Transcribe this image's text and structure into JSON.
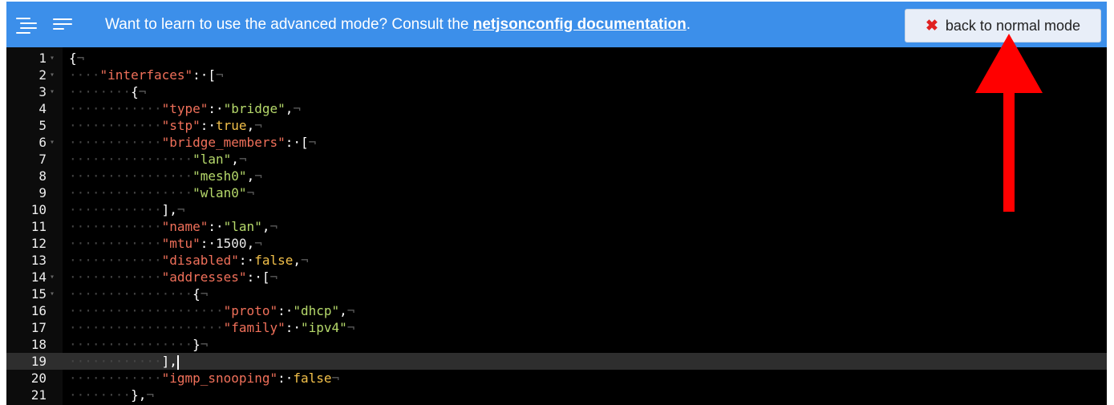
{
  "toolbar": {
    "message_prefix": "Want to learn to use the advanced mode? Consult the ",
    "doc_link": "netjsonconfig documentation",
    "message_suffix": ".",
    "back_button": {
      "icon": "✖",
      "label": "back to normal mode"
    }
  },
  "editor": {
    "active_line": 19,
    "lines": [
      {
        "n": "1",
        "fold": true,
        "tokens": [
          [
            "p",
            "{"
          ],
          [
            "e",
            "¬"
          ]
        ]
      },
      {
        "n": "2",
        "fold": true,
        "tokens": [
          [
            "ws",
            "····"
          ],
          [
            "k",
            "\"interfaces\""
          ],
          [
            "p",
            ":·["
          ],
          [
            "e",
            "¬"
          ]
        ]
      },
      {
        "n": "3",
        "fold": true,
        "tokens": [
          [
            "ws",
            "········"
          ],
          [
            "p",
            "{"
          ],
          [
            "e",
            "¬"
          ]
        ]
      },
      {
        "n": "4",
        "fold": false,
        "tokens": [
          [
            "ws",
            "············"
          ],
          [
            "k",
            "\"type\""
          ],
          [
            "p",
            ":·"
          ],
          [
            "s",
            "\"bridge\""
          ],
          [
            "p",
            ","
          ],
          [
            "e",
            "¬"
          ]
        ]
      },
      {
        "n": "5",
        "fold": false,
        "tokens": [
          [
            "ws",
            "············"
          ],
          [
            "k",
            "\"stp\""
          ],
          [
            "p",
            ":·"
          ],
          [
            "b",
            "true"
          ],
          [
            "p",
            ","
          ],
          [
            "e",
            "¬"
          ]
        ]
      },
      {
        "n": "6",
        "fold": true,
        "tokens": [
          [
            "ws",
            "············"
          ],
          [
            "k",
            "\"bridge_members\""
          ],
          [
            "p",
            ":·["
          ],
          [
            "e",
            "¬"
          ]
        ]
      },
      {
        "n": "7",
        "fold": false,
        "tokens": [
          [
            "ws",
            "················"
          ],
          [
            "s",
            "\"lan\""
          ],
          [
            "p",
            ","
          ],
          [
            "e",
            "¬"
          ]
        ]
      },
      {
        "n": "8",
        "fold": false,
        "tokens": [
          [
            "ws",
            "················"
          ],
          [
            "s",
            "\"mesh0\""
          ],
          [
            "p",
            ","
          ],
          [
            "e",
            "¬"
          ]
        ]
      },
      {
        "n": "9",
        "fold": false,
        "tokens": [
          [
            "ws",
            "················"
          ],
          [
            "s",
            "\"wlan0\""
          ],
          [
            "e",
            "¬"
          ]
        ]
      },
      {
        "n": "10",
        "fold": false,
        "tokens": [
          [
            "ws",
            "············"
          ],
          [
            "p",
            "],"
          ],
          [
            "e",
            "¬"
          ]
        ]
      },
      {
        "n": "11",
        "fold": false,
        "tokens": [
          [
            "ws",
            "············"
          ],
          [
            "k",
            "\"name\""
          ],
          [
            "p",
            ":·"
          ],
          [
            "s",
            "\"lan\""
          ],
          [
            "p",
            ","
          ],
          [
            "e",
            "¬"
          ]
        ]
      },
      {
        "n": "12",
        "fold": false,
        "tokens": [
          [
            "ws",
            "············"
          ],
          [
            "k",
            "\"mtu\""
          ],
          [
            "p",
            ":·"
          ],
          [
            "n",
            "1500"
          ],
          [
            "p",
            ","
          ],
          [
            "e",
            "¬"
          ]
        ]
      },
      {
        "n": "13",
        "fold": false,
        "tokens": [
          [
            "ws",
            "············"
          ],
          [
            "k",
            "\"disabled\""
          ],
          [
            "p",
            ":·"
          ],
          [
            "b",
            "false"
          ],
          [
            "p",
            ","
          ],
          [
            "e",
            "¬"
          ]
        ]
      },
      {
        "n": "14",
        "fold": true,
        "tokens": [
          [
            "ws",
            "············"
          ],
          [
            "k",
            "\"addresses\""
          ],
          [
            "p",
            ":·["
          ],
          [
            "e",
            "¬"
          ]
        ]
      },
      {
        "n": "15",
        "fold": true,
        "tokens": [
          [
            "ws",
            "················"
          ],
          [
            "p",
            "{"
          ],
          [
            "e",
            "¬"
          ]
        ]
      },
      {
        "n": "16",
        "fold": false,
        "tokens": [
          [
            "ws",
            "····················"
          ],
          [
            "k",
            "\"proto\""
          ],
          [
            "p",
            ":·"
          ],
          [
            "s",
            "\"dhcp\""
          ],
          [
            "p",
            ","
          ],
          [
            "e",
            "¬"
          ]
        ]
      },
      {
        "n": "17",
        "fold": false,
        "tokens": [
          [
            "ws",
            "····················"
          ],
          [
            "k",
            "\"family\""
          ],
          [
            "p",
            ":·"
          ],
          [
            "s",
            "\"ipv4\""
          ],
          [
            "e",
            "¬"
          ]
        ]
      },
      {
        "n": "18",
        "fold": false,
        "tokens": [
          [
            "ws",
            "················"
          ],
          [
            "p",
            "}"
          ],
          [
            "e",
            "¬"
          ]
        ]
      },
      {
        "n": "19",
        "fold": false,
        "tokens": [
          [
            "ws",
            "············"
          ],
          [
            "p",
            "],"
          ]
        ]
      },
      {
        "n": "20",
        "fold": false,
        "tokens": [
          [
            "ws",
            "············"
          ],
          [
            "k",
            "\"igmp_snooping\""
          ],
          [
            "p",
            ":·"
          ],
          [
            "b",
            "false"
          ],
          [
            "e",
            "¬"
          ]
        ]
      },
      {
        "n": "21",
        "fold": false,
        "tokens": [
          [
            "ws",
            "········"
          ],
          [
            "p",
            "},"
          ],
          [
            "e",
            "¬"
          ]
        ]
      }
    ]
  },
  "annotation": {
    "color": "#ff0000"
  }
}
